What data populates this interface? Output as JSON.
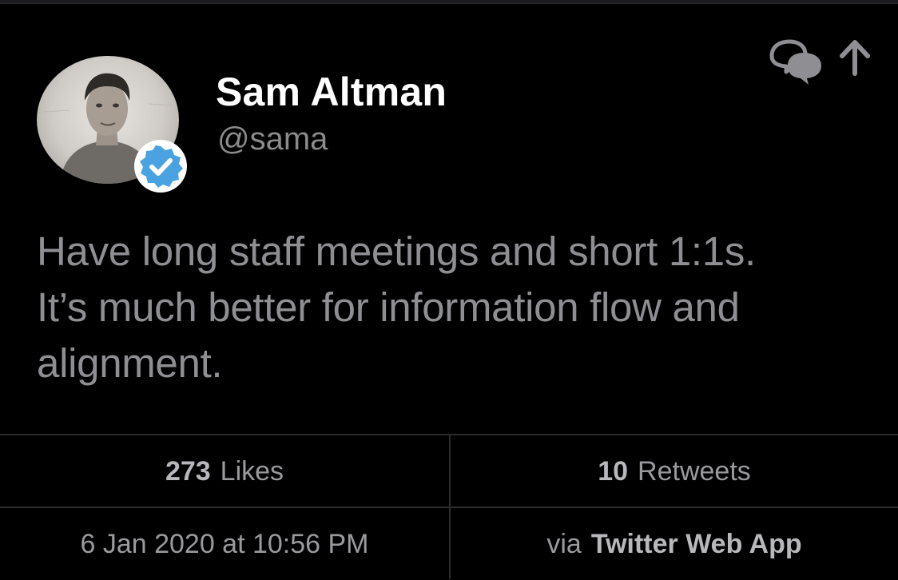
{
  "user": {
    "display_name": "Sam Altman",
    "handle": "@sama",
    "verified": true
  },
  "tweet": {
    "lines": [
      "Have long staff meetings and short 1:1s.",
      "It’s much better for information flow and",
      "alignment."
    ]
  },
  "stats": {
    "likes_count": "273",
    "likes_label": "Likes",
    "retweets_count": "10",
    "retweets_label": "Retweets"
  },
  "meta": {
    "timestamp": "6 Jan 2020 at 10:56 PM",
    "via_label": "via",
    "app_name": "Twitter Web App"
  },
  "icons": {
    "reply": "reply-icon",
    "share": "share-icon",
    "verified": "verified-badge-icon"
  },
  "colors": {
    "background": "#000000",
    "name": "#ffffff",
    "handle": "#8b8b8b",
    "tweet_text": "#8e8e93",
    "verified_blue": "#4aa3e0",
    "divider": "#2c2c2e"
  }
}
